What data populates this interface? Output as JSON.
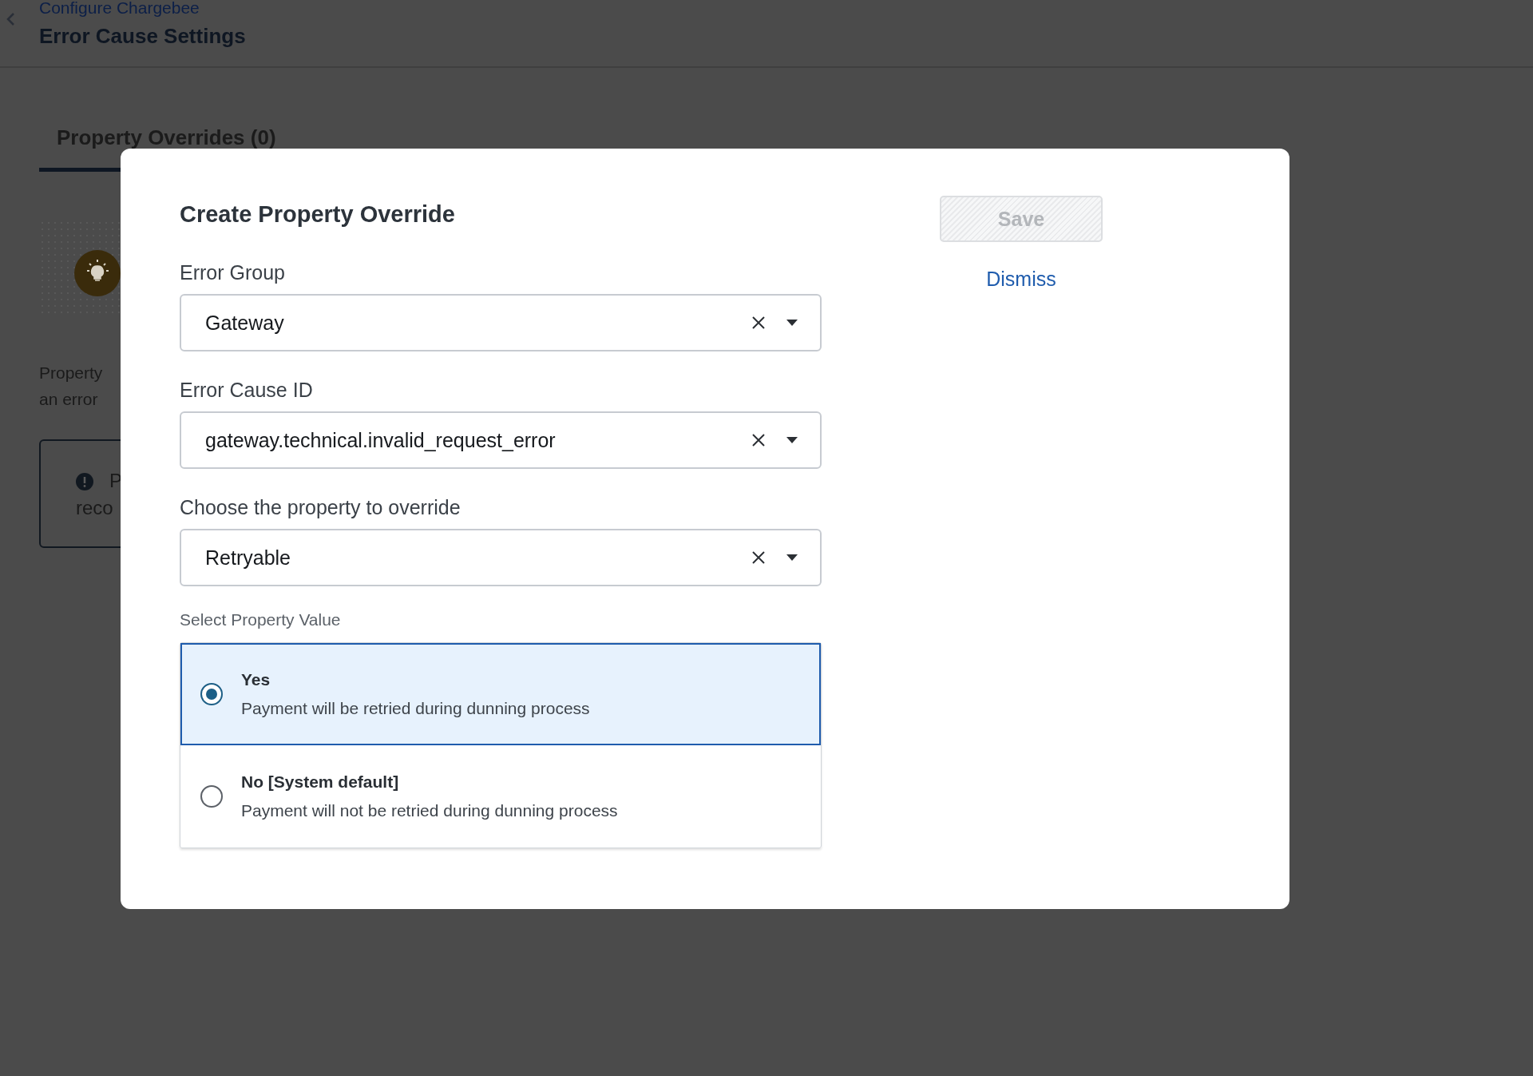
{
  "page": {
    "breadcrumb": "Configure Chargebee",
    "title": "Error Cause Settings",
    "tabs": [
      {
        "label": "Property Overrides (0)",
        "selected": true
      }
    ],
    "description_lines": [
      "Property",
      "an error"
    ],
    "alert_lines": [
      "P",
      "reco"
    ]
  },
  "modal": {
    "title": "Create Property Override",
    "fields": [
      {
        "label": "Error Group",
        "value": "Gateway"
      },
      {
        "label": "Error Cause ID",
        "value": "gateway.technical.invalid_request_error"
      },
      {
        "label": "Choose the property to override",
        "value": "Retryable"
      }
    ],
    "value_label": "Select Property Value",
    "options": [
      {
        "title": "Yes",
        "description": "Payment will be retried during dunning process",
        "selected": true
      },
      {
        "title": "No [System default]",
        "description": "Payment will not be retried during dunning process",
        "selected": false
      }
    ],
    "save": {
      "label": "Save",
      "disabled": true
    },
    "dismiss": "Dismiss"
  }
}
